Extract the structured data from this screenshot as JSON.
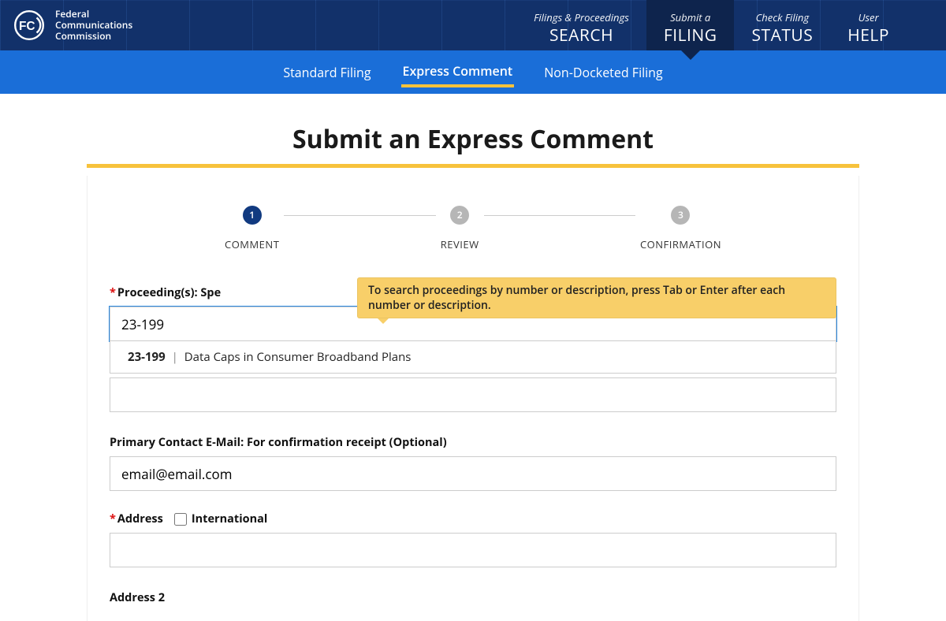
{
  "header": {
    "agency": "Federal\nCommunications\nCommission",
    "nav": [
      {
        "sup": "Filings & Proceedings",
        "main": "SEARCH"
      },
      {
        "sup": "Submit a",
        "main": "FILING"
      },
      {
        "sup": "Check Filing",
        "main": "STATUS"
      },
      {
        "sup": "User",
        "main": "HELP"
      }
    ],
    "active_nav": 1
  },
  "subnav": {
    "items": [
      "Standard Filing",
      "Express Comment",
      "Non-Docketed Filing"
    ],
    "active": 1
  },
  "page_title": "Submit an Express Comment",
  "steps": {
    "labels": [
      "COMMENT",
      "REVIEW",
      "CONFIRMATION"
    ],
    "active": 0
  },
  "tooltip": "To search proceedings by number or description, press Tab or Enter after each number or description.",
  "proceedings": {
    "label_prefix": "Proceeding(s): Spe",
    "typed_value": "23-199",
    "suggestion": {
      "number": "23-199",
      "title": "Data Caps in Consumer Broadband Plans"
    }
  },
  "email": {
    "label": "Primary Contact E-Mail: For confirmation receipt (Optional)",
    "value": "email@email.com"
  },
  "address": {
    "label": "Address",
    "intl_label": "International",
    "value": ""
  },
  "address2": {
    "label": "Address 2"
  }
}
